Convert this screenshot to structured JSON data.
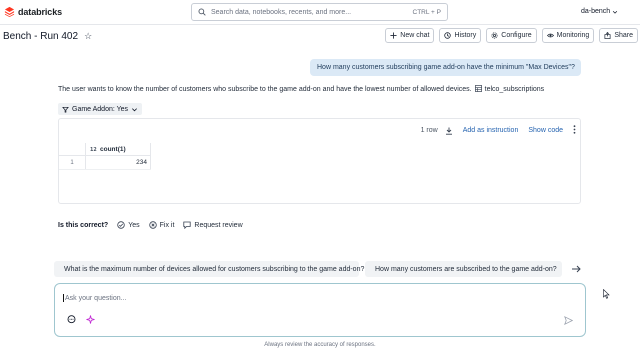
{
  "header": {
    "brand": "databricks",
    "search_placeholder": "Search data, notebooks, recents, and more...",
    "search_shortcut": "CTRL + P",
    "workspace": "da-bench"
  },
  "page": {
    "title": "Bench - Run 402"
  },
  "toolbar": {
    "new_chat": "New chat",
    "history": "History",
    "configure": "Configure",
    "monitoring": "Monitoring",
    "share": "Share"
  },
  "conversation": {
    "user_message": "How many customers subscribing game add-on have the minimum \"Max Devices\"?",
    "assistant_text": "The user wants to know the number of customers who subscribe to the game add-on and have the lowest number of allowed devices.",
    "table_ref": "telco_subscriptions",
    "filter_chip": "Game Addon: Yes"
  },
  "result": {
    "row_count": "1 row",
    "add_instruction": "Add as instruction",
    "show_code": "Show code",
    "columns": [
      "count(1)"
    ],
    "rows": [
      {
        "index": "1",
        "value": "234"
      }
    ]
  },
  "feedback": {
    "label": "Is this correct?",
    "yes": "Yes",
    "fix_it": "Fix it",
    "request_review": "Request review"
  },
  "suggestions": [
    "What is the maximum number of devices allowed for customers subscribing to the game add-on?",
    "How many customers are subscribed to the game add-on?"
  ],
  "composer": {
    "placeholder": "Ask your question...",
    "disclaimer": "Always review the accuracy of responses."
  },
  "colors": {
    "brand_red": "#ff3621",
    "user_bubble": "#dbe9f6",
    "link_blue": "#2563b0",
    "composer_border": "#9fc6cf"
  }
}
